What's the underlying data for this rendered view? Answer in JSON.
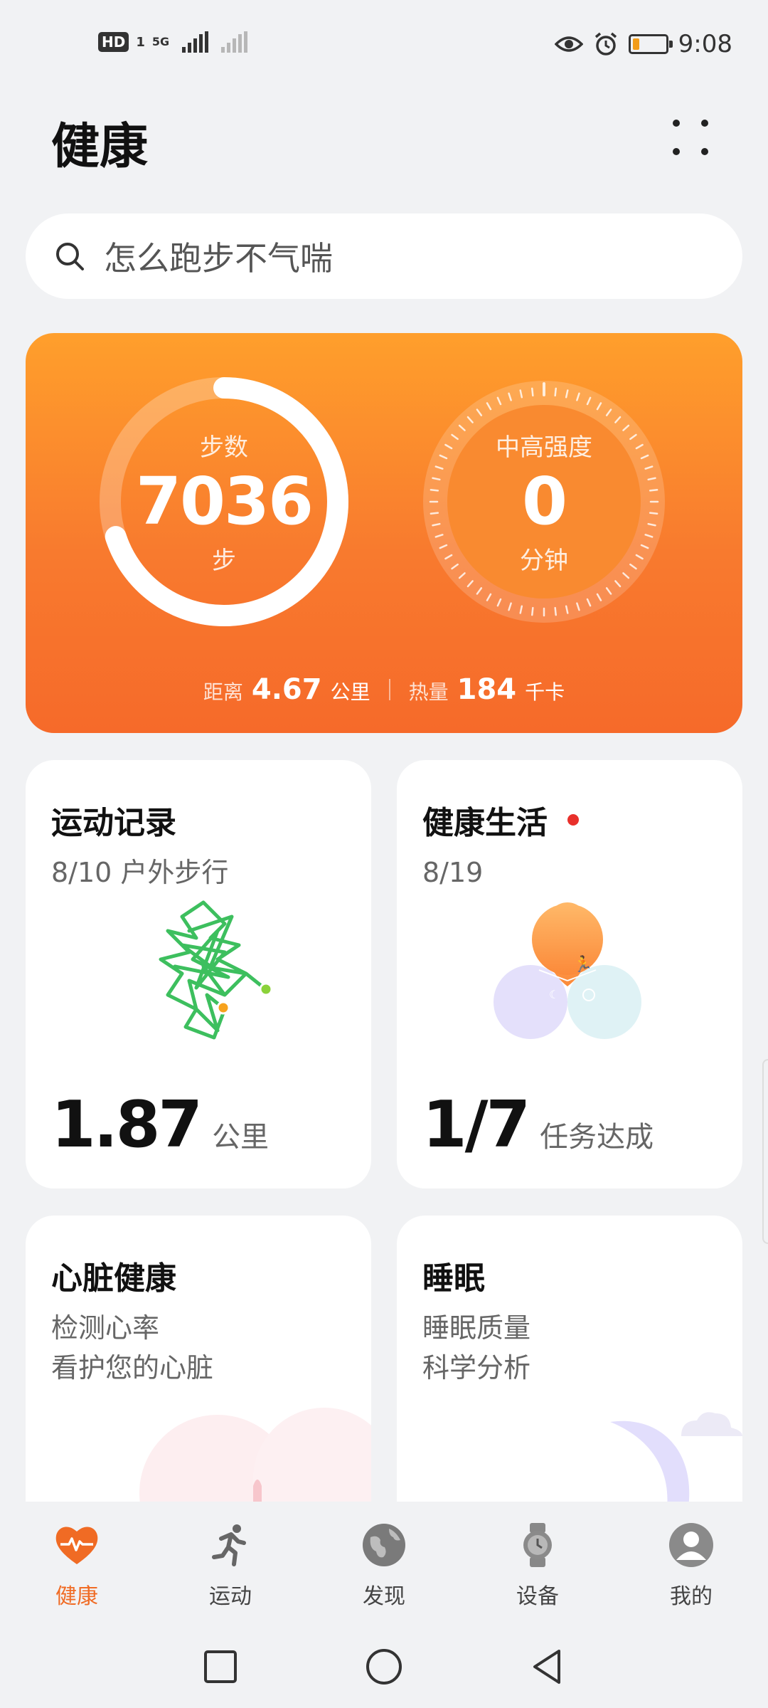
{
  "status_bar": {
    "hd": "HD",
    "sim": "1",
    "network": "5G",
    "time": "9:08"
  },
  "header": {
    "title": "健康"
  },
  "search": {
    "placeholder": "怎么跑步不气喘"
  },
  "activity": {
    "steps_label": "步数",
    "steps_value": "7036",
    "steps_unit": "步",
    "steps_progress": 0.7,
    "intensity_label": "中高强度",
    "intensity_value": "0",
    "intensity_unit": "分钟",
    "distance_label": "距离",
    "distance_value": "4.67",
    "distance_unit": "公里",
    "calories_label": "热量",
    "calories_value": "184",
    "calories_unit": "千卡"
  },
  "tiles": {
    "exercise": {
      "title": "运动记录",
      "subtitle": "8/10 户外步行",
      "value": "1.87",
      "unit": "公里"
    },
    "healthy_living": {
      "title": "健康生活",
      "subtitle": "8/19",
      "value": "1/7",
      "unit": "任务达成"
    },
    "heart": {
      "title": "心脏健康",
      "line1": "检测心率",
      "line2": "看护您的心脏"
    },
    "sleep": {
      "title": "睡眠",
      "line1": "睡眠质量",
      "line2": "科学分析"
    }
  },
  "nav": {
    "items": [
      {
        "label": "健康",
        "icon": "heart-pulse-icon",
        "active": true
      },
      {
        "label": "运动",
        "icon": "running-icon"
      },
      {
        "label": "发现",
        "icon": "globe-icon"
      },
      {
        "label": "设备",
        "icon": "watch-icon"
      },
      {
        "label": "我的",
        "icon": "profile-icon"
      }
    ]
  },
  "colors": {
    "accent": "#f06b24",
    "card_orange": "#f87a2e",
    "route_green": "#3dbf5e"
  }
}
